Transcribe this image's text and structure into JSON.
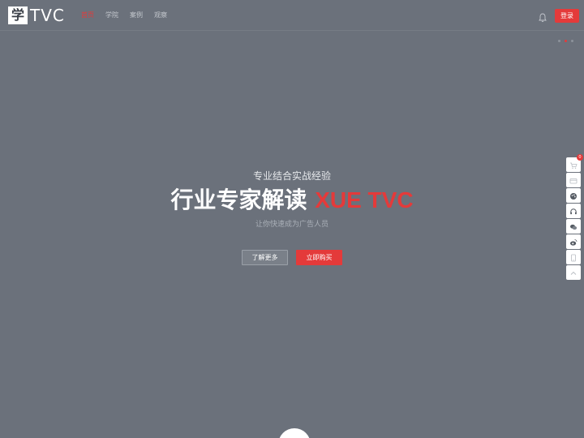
{
  "header": {
    "logo_glyph": "学",
    "logo_text": "TVC",
    "nav": [
      {
        "label": "首页",
        "active": true
      },
      {
        "label": "学院",
        "active": false
      },
      {
        "label": "案例",
        "active": false
      },
      {
        "label": "观察",
        "active": false
      }
    ],
    "login_label": "登录"
  },
  "hero": {
    "subtitle": "专业结合实战经验",
    "title_main": "行业专家解读 ",
    "title_accent": "XUE TVC",
    "description": "让你快速成为广告人员",
    "learn_more_label": "了解更多",
    "buy_now_label": "立即购买"
  },
  "toolbar": {
    "cart_badge": "0",
    "icons": [
      "cart-icon",
      "card-icon",
      "palette-icon",
      "headset-icon",
      "chat-icon",
      "weibo-icon",
      "tablet-icon",
      "arrow-up-icon"
    ]
  },
  "colors": {
    "background": "#6b717b",
    "accent": "#e43a3a"
  }
}
